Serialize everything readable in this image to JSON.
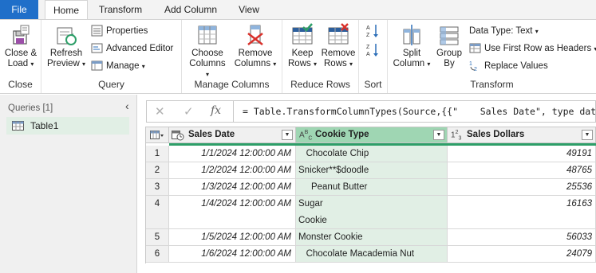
{
  "tabs": [
    "File",
    "Home",
    "Transform",
    "Add Column",
    "View"
  ],
  "ribbon": {
    "close_group": {
      "label": "Close",
      "close_load": [
        "Close &",
        "Load"
      ]
    },
    "query_group": {
      "label": "Query",
      "refresh": [
        "Refresh",
        "Preview"
      ],
      "properties": "Properties",
      "advanced_editor": "Advanced Editor",
      "manage": "Manage"
    },
    "manage_columns_group": {
      "label": "Manage Columns",
      "choose": [
        "Choose",
        "Columns"
      ],
      "remove": [
        "Remove",
        "Columns"
      ]
    },
    "reduce_rows_group": {
      "label": "Reduce Rows",
      "keep": [
        "Keep",
        "Rows"
      ],
      "remove": [
        "Remove",
        "Rows"
      ]
    },
    "sort_group": {
      "label": "Sort"
    },
    "transform_group": {
      "label": "Transform",
      "split": [
        "Split",
        "Column"
      ],
      "group_by": [
        "Group",
        "By"
      ],
      "data_type": "Data Type: Text",
      "first_row": "Use First Row as Headers",
      "replace": "Replace Values"
    }
  },
  "queries": {
    "header": "Queries [1]",
    "items": [
      "Table1"
    ]
  },
  "formula": {
    "fx": "fx",
    "text": "= Table.TransformColumnTypes(Source,{{\"    Sales Date\", type datet"
  },
  "table": {
    "columns": [
      {
        "name": "Sales Date",
        "type": "date-time"
      },
      {
        "name": "Cookie Type",
        "type": "text"
      },
      {
        "name": "Sales Dollars",
        "type": "whole-number"
      }
    ],
    "rows": [
      {
        "n": "1",
        "date": "1/1/2024 12:00:00 AM",
        "cookie": [
          "   Chocolate Chip"
        ],
        "sales": "49191"
      },
      {
        "n": "2",
        "date": "1/2/2024 12:00:00 AM",
        "cookie": [
          "Snicker**$doodle"
        ],
        "sales": "48765"
      },
      {
        "n": "3",
        "date": "1/3/2024 12:00:00 AM",
        "cookie": [
          "     Peanut Butter"
        ],
        "sales": "25536"
      },
      {
        "n": "4",
        "date": "1/4/2024 12:00:00 AM",
        "cookie": [
          "Sugar",
          "Cookie"
        ],
        "sales": "16163"
      },
      {
        "n": "5",
        "date": "1/5/2024 12:00:00 AM",
        "cookie": [
          "Monster Cookie"
        ],
        "sales": "56033"
      },
      {
        "n": "6",
        "date": "1/6/2024 12:00:00 AM",
        "cookie": [
          "   Chocolate Macademia Nut"
        ],
        "sales": "24079"
      }
    ]
  },
  "colors": {
    "file_tab": "#1f6fc9",
    "selected_column": "#9fd6b3",
    "selected_cells": "#e1efe5",
    "quality_bar": "#2d9e68"
  }
}
